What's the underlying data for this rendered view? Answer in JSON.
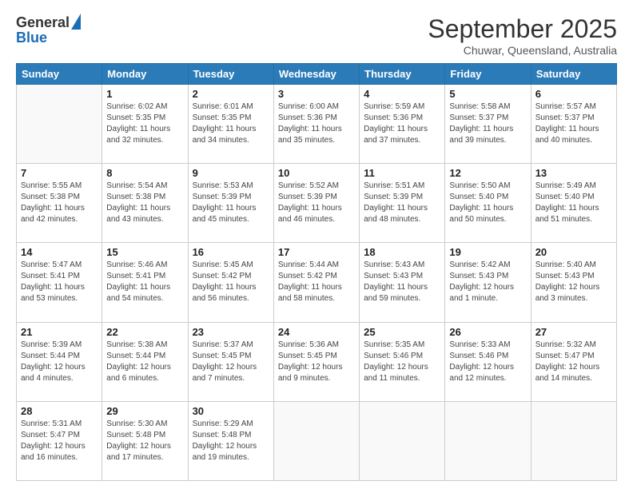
{
  "logo": {
    "general": "General",
    "blue": "Blue"
  },
  "title": "September 2025",
  "subtitle": "Chuwar, Queensland, Australia",
  "days": [
    "Sunday",
    "Monday",
    "Tuesday",
    "Wednesday",
    "Thursday",
    "Friday",
    "Saturday"
  ],
  "weeks": [
    [
      {
        "day": "",
        "info": ""
      },
      {
        "day": "1",
        "info": "Sunrise: 6:02 AM\nSunset: 5:35 PM\nDaylight: 11 hours\nand 32 minutes."
      },
      {
        "day": "2",
        "info": "Sunrise: 6:01 AM\nSunset: 5:35 PM\nDaylight: 11 hours\nand 34 minutes."
      },
      {
        "day": "3",
        "info": "Sunrise: 6:00 AM\nSunset: 5:36 PM\nDaylight: 11 hours\nand 35 minutes."
      },
      {
        "day": "4",
        "info": "Sunrise: 5:59 AM\nSunset: 5:36 PM\nDaylight: 11 hours\nand 37 minutes."
      },
      {
        "day": "5",
        "info": "Sunrise: 5:58 AM\nSunset: 5:37 PM\nDaylight: 11 hours\nand 39 minutes."
      },
      {
        "day": "6",
        "info": "Sunrise: 5:57 AM\nSunset: 5:37 PM\nDaylight: 11 hours\nand 40 minutes."
      }
    ],
    [
      {
        "day": "7",
        "info": "Sunrise: 5:55 AM\nSunset: 5:38 PM\nDaylight: 11 hours\nand 42 minutes."
      },
      {
        "day": "8",
        "info": "Sunrise: 5:54 AM\nSunset: 5:38 PM\nDaylight: 11 hours\nand 43 minutes."
      },
      {
        "day": "9",
        "info": "Sunrise: 5:53 AM\nSunset: 5:39 PM\nDaylight: 11 hours\nand 45 minutes."
      },
      {
        "day": "10",
        "info": "Sunrise: 5:52 AM\nSunset: 5:39 PM\nDaylight: 11 hours\nand 46 minutes."
      },
      {
        "day": "11",
        "info": "Sunrise: 5:51 AM\nSunset: 5:39 PM\nDaylight: 11 hours\nand 48 minutes."
      },
      {
        "day": "12",
        "info": "Sunrise: 5:50 AM\nSunset: 5:40 PM\nDaylight: 11 hours\nand 50 minutes."
      },
      {
        "day": "13",
        "info": "Sunrise: 5:49 AM\nSunset: 5:40 PM\nDaylight: 11 hours\nand 51 minutes."
      }
    ],
    [
      {
        "day": "14",
        "info": "Sunrise: 5:47 AM\nSunset: 5:41 PM\nDaylight: 11 hours\nand 53 minutes."
      },
      {
        "day": "15",
        "info": "Sunrise: 5:46 AM\nSunset: 5:41 PM\nDaylight: 11 hours\nand 54 minutes."
      },
      {
        "day": "16",
        "info": "Sunrise: 5:45 AM\nSunset: 5:42 PM\nDaylight: 11 hours\nand 56 minutes."
      },
      {
        "day": "17",
        "info": "Sunrise: 5:44 AM\nSunset: 5:42 PM\nDaylight: 11 hours\nand 58 minutes."
      },
      {
        "day": "18",
        "info": "Sunrise: 5:43 AM\nSunset: 5:43 PM\nDaylight: 11 hours\nand 59 minutes."
      },
      {
        "day": "19",
        "info": "Sunrise: 5:42 AM\nSunset: 5:43 PM\nDaylight: 12 hours\nand 1 minute."
      },
      {
        "day": "20",
        "info": "Sunrise: 5:40 AM\nSunset: 5:43 PM\nDaylight: 12 hours\nand 3 minutes."
      }
    ],
    [
      {
        "day": "21",
        "info": "Sunrise: 5:39 AM\nSunset: 5:44 PM\nDaylight: 12 hours\nand 4 minutes."
      },
      {
        "day": "22",
        "info": "Sunrise: 5:38 AM\nSunset: 5:44 PM\nDaylight: 12 hours\nand 6 minutes."
      },
      {
        "day": "23",
        "info": "Sunrise: 5:37 AM\nSunset: 5:45 PM\nDaylight: 12 hours\nand 7 minutes."
      },
      {
        "day": "24",
        "info": "Sunrise: 5:36 AM\nSunset: 5:45 PM\nDaylight: 12 hours\nand 9 minutes."
      },
      {
        "day": "25",
        "info": "Sunrise: 5:35 AM\nSunset: 5:46 PM\nDaylight: 12 hours\nand 11 minutes."
      },
      {
        "day": "26",
        "info": "Sunrise: 5:33 AM\nSunset: 5:46 PM\nDaylight: 12 hours\nand 12 minutes."
      },
      {
        "day": "27",
        "info": "Sunrise: 5:32 AM\nSunset: 5:47 PM\nDaylight: 12 hours\nand 14 minutes."
      }
    ],
    [
      {
        "day": "28",
        "info": "Sunrise: 5:31 AM\nSunset: 5:47 PM\nDaylight: 12 hours\nand 16 minutes."
      },
      {
        "day": "29",
        "info": "Sunrise: 5:30 AM\nSunset: 5:48 PM\nDaylight: 12 hours\nand 17 minutes."
      },
      {
        "day": "30",
        "info": "Sunrise: 5:29 AM\nSunset: 5:48 PM\nDaylight: 12 hours\nand 19 minutes."
      },
      {
        "day": "",
        "info": ""
      },
      {
        "day": "",
        "info": ""
      },
      {
        "day": "",
        "info": ""
      },
      {
        "day": "",
        "info": ""
      }
    ]
  ]
}
